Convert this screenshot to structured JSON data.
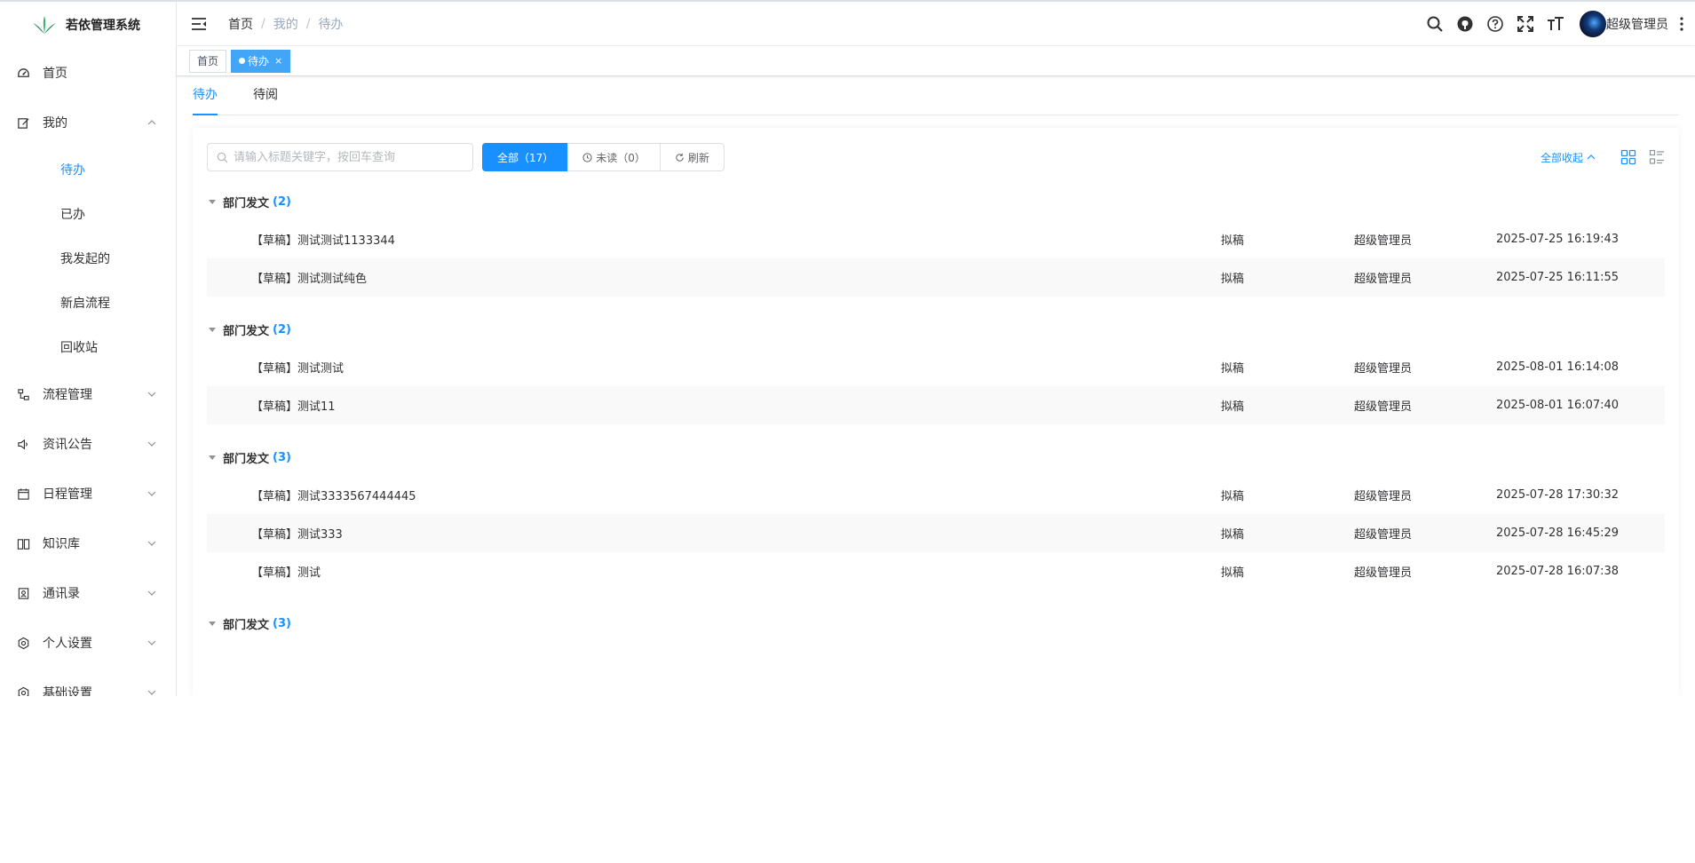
{
  "app": {
    "title": "若依管理系统"
  },
  "sidebar": {
    "items": [
      {
        "label": "首页",
        "icon": "dashboard-icon"
      },
      {
        "label": "我的",
        "icon": "edit-icon",
        "expanded": true,
        "children": [
          {
            "label": "待办",
            "active": true
          },
          {
            "label": "已办"
          },
          {
            "label": "我发起的"
          },
          {
            "label": "新启流程"
          },
          {
            "label": "回收站"
          }
        ]
      },
      {
        "label": "流程管理",
        "icon": "flow-icon"
      },
      {
        "label": "资讯公告",
        "icon": "speaker-icon"
      },
      {
        "label": "日程管理",
        "icon": "calendar-icon"
      },
      {
        "label": "知识库",
        "icon": "book-icon"
      },
      {
        "label": "通讯录",
        "icon": "contacts-icon"
      },
      {
        "label": "个人设置",
        "icon": "gear-icon"
      },
      {
        "label": "基础设置",
        "icon": "gear-icon"
      }
    ]
  },
  "breadcrumb": {
    "items": [
      "首页",
      "我的",
      "待办"
    ],
    "separator": "/"
  },
  "header": {
    "user_name": "超级管理员"
  },
  "tags": {
    "home": "首页",
    "active": "待办",
    "close": "×"
  },
  "tabs": [
    {
      "label": "待办",
      "active": true
    },
    {
      "label": "待阅",
      "active": false
    }
  ],
  "toolbar": {
    "search_placeholder": "请输入标题关键字，按回车查询",
    "buttons": {
      "all": "全部（17）",
      "unread": "未读（0）",
      "refresh": "刷新"
    },
    "collapse_all": "全部收起"
  },
  "groups": [
    {
      "name": "部门发文",
      "count": "(2)",
      "rows": [
        {
          "title": "【草稿】测试测试1133344",
          "status": "拟稿",
          "user": "超级管理员",
          "time": "2025-07-25 16:19:43"
        },
        {
          "title": "【草稿】测试测试纯色",
          "status": "拟稿",
          "user": "超级管理员",
          "time": "2025-07-25 16:11:55"
        }
      ]
    },
    {
      "name": "部门发文",
      "count": "(2)",
      "rows": [
        {
          "title": "【草稿】测试测试",
          "status": "拟稿",
          "user": "超级管理员",
          "time": "2025-08-01 16:14:08"
        },
        {
          "title": "【草稿】测试11",
          "status": "拟稿",
          "user": "超级管理员",
          "time": "2025-08-01 16:07:40"
        }
      ]
    },
    {
      "name": "部门发文",
      "count": "(3)",
      "rows": [
        {
          "title": "【草稿】测试3333567444445",
          "status": "拟稿",
          "user": "超级管理员",
          "time": "2025-07-28 17:30:32"
        },
        {
          "title": "【草稿】测试333",
          "status": "拟稿",
          "user": "超级管理员",
          "time": "2025-07-28 16:45:29"
        },
        {
          "title": "【草稿】测试",
          "status": "拟稿",
          "user": "超级管理员",
          "time": "2025-07-28 16:07:38"
        }
      ]
    },
    {
      "name": "部门发文",
      "count": "(3)",
      "rows": []
    }
  ],
  "colors": {
    "primary": "#1890ff",
    "tag_active": "#42a5f5"
  }
}
